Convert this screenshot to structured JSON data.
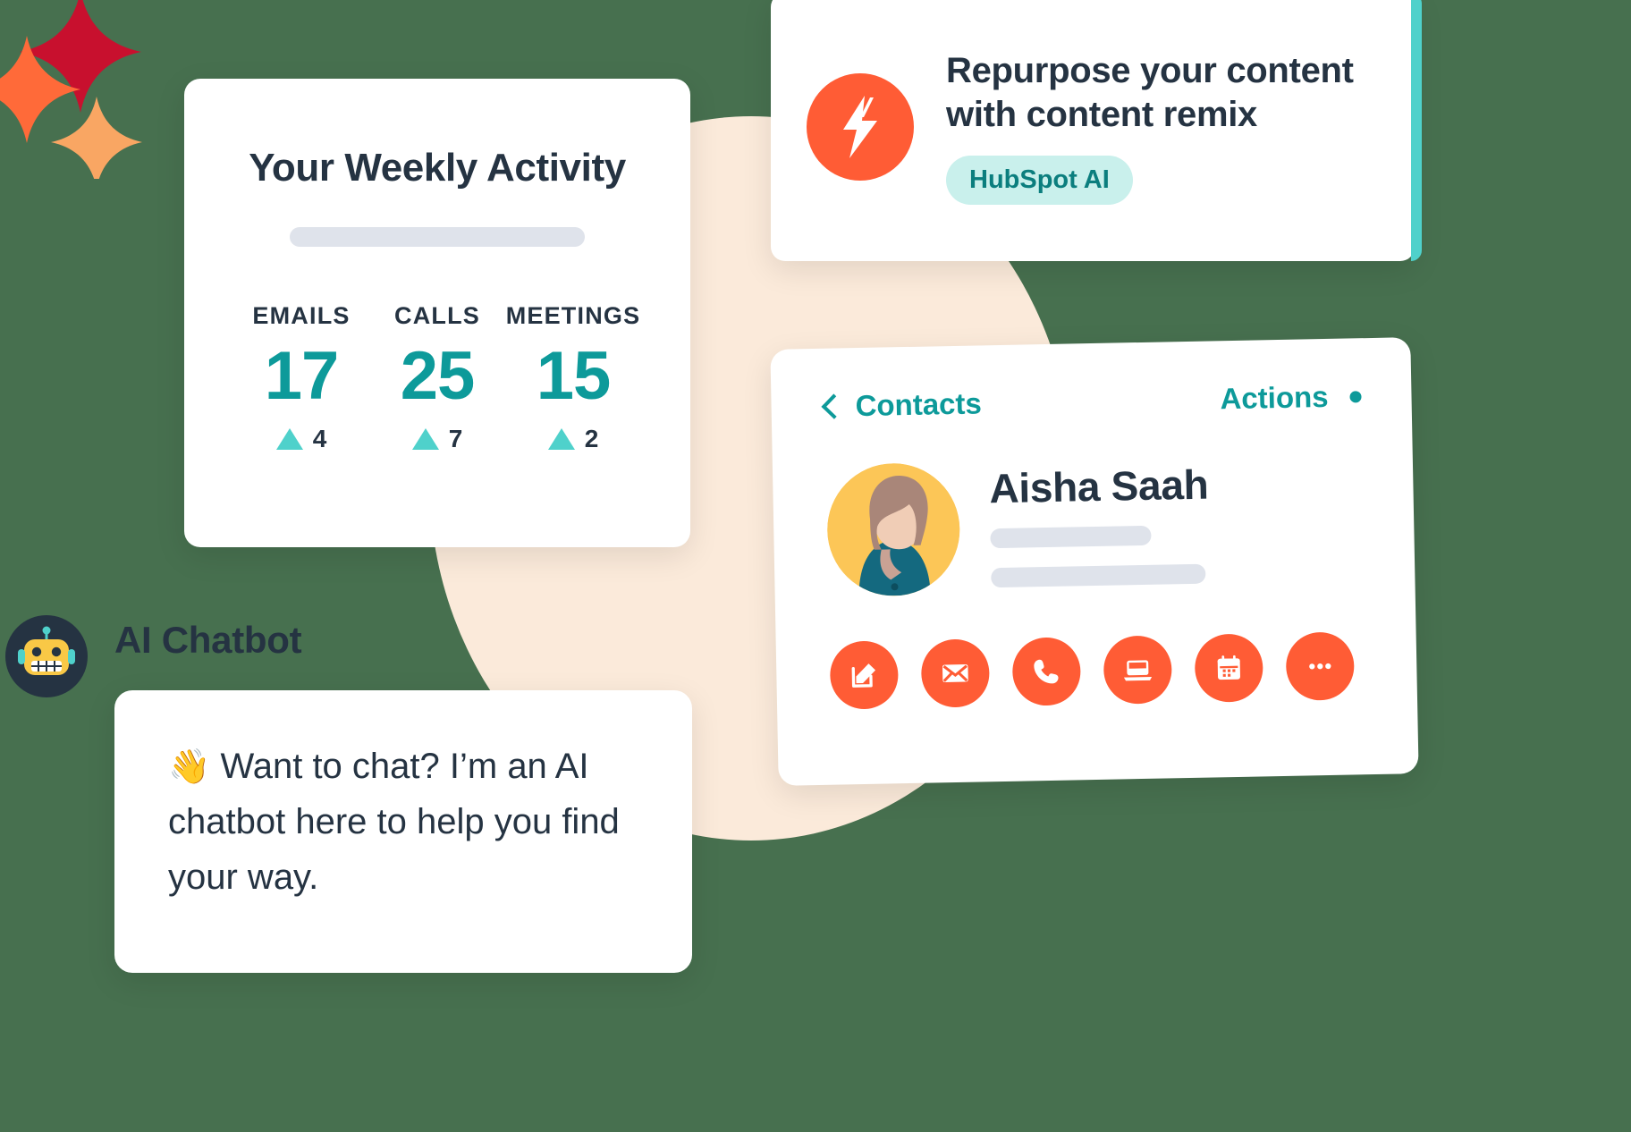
{
  "theme": {
    "background": "#47704f",
    "blob": "#fbeada",
    "teal": "#0d9a9a",
    "teal_light": "#4fd1cb",
    "orange": "#ff5c35",
    "navy": "#253342",
    "skeleton_gray": "#dfe3eb",
    "pill_bg": "#c9f0ec",
    "pill_text": "#0b7e7e",
    "avatar_bg": "#fcc657"
  },
  "sparkles": [
    {
      "name": "sparkle-crimson",
      "color": "#c8102e"
    },
    {
      "name": "sparkle-orange",
      "color": "#ff6a39"
    },
    {
      "name": "sparkle-peach",
      "color": "#f9a663"
    }
  ],
  "weekly_activity": {
    "title": "Your Weekly Activity",
    "stats": [
      {
        "label": "EMAILS",
        "value": "17",
        "delta": "4",
        "trend": "up"
      },
      {
        "label": "CALLS",
        "value": "25",
        "delta": "7",
        "trend": "up"
      },
      {
        "label": "MEETINGS",
        "value": "15",
        "delta": "2",
        "trend": "up"
      }
    ]
  },
  "remix_card": {
    "icon": "lightning-bolt-icon",
    "headline_line1": "Repurpose your content",
    "headline_line2": "with content remix",
    "pill": "HubSpot AI"
  },
  "contacts_card": {
    "back_label": "Contacts",
    "back_icon": "chevron-left-icon",
    "actions_label": "Actions",
    "contact_name": "Aisha Saah",
    "avatar": "contact-photo",
    "action_buttons": [
      {
        "name": "note-icon",
        "label": "Note"
      },
      {
        "name": "email-icon",
        "label": "Email"
      },
      {
        "name": "call-icon",
        "label": "Call"
      },
      {
        "name": "meeting-icon",
        "label": "Meeting"
      },
      {
        "name": "schedule-icon",
        "label": "Schedule"
      },
      {
        "name": "more-icon",
        "label": "More"
      }
    ]
  },
  "chatbot": {
    "label": "AI Chatbot",
    "avatar_icon": "robot-icon",
    "wave_emoji": "👋",
    "message": "Want to chat? I’m an AI chatbot here to help you find your way."
  },
  "chart_data": {
    "type": "bar",
    "title": "Your Weekly Activity",
    "categories": [
      "EMAILS",
      "CALLS",
      "MEETINGS"
    ],
    "values": [
      17,
      25,
      15
    ],
    "deltas": [
      4,
      7,
      2
    ],
    "xlabel": "",
    "ylabel": "",
    "legend": "none"
  }
}
